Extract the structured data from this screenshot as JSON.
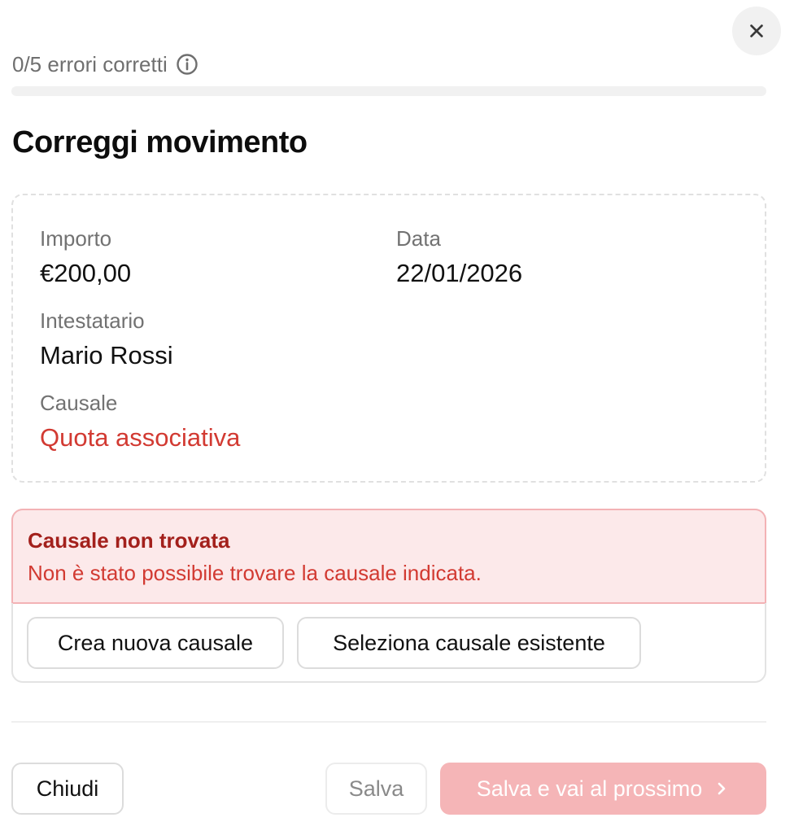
{
  "progress": {
    "label": "0/5 errori corretti",
    "corrected": 0,
    "total": 5,
    "accent_color": "#d32f2f"
  },
  "icons": {
    "close": "close-icon",
    "info": "info-circle-icon",
    "next": "chevron-right-icon"
  },
  "title": "Correggi movimento",
  "details": {
    "amount": {
      "label": "Importo",
      "value": "€200,00"
    },
    "date": {
      "label": "Data",
      "value": "22/01/2026"
    },
    "holder": {
      "label": "Intestatario",
      "value": "Mario Rossi"
    },
    "reason": {
      "label": "Causale",
      "value": "Quota associativa",
      "status_color": "#d23a32"
    }
  },
  "error": {
    "title": "Causale non trovata",
    "message": "Non è stato possibile trovare la causale indicata.",
    "actions": {
      "create": "Crea nuova causale",
      "select": "Seleziona causale esistente"
    }
  },
  "footer": {
    "close": "Chiudi",
    "save": "Salva",
    "save_next": "Salva e vai al prossimo"
  }
}
